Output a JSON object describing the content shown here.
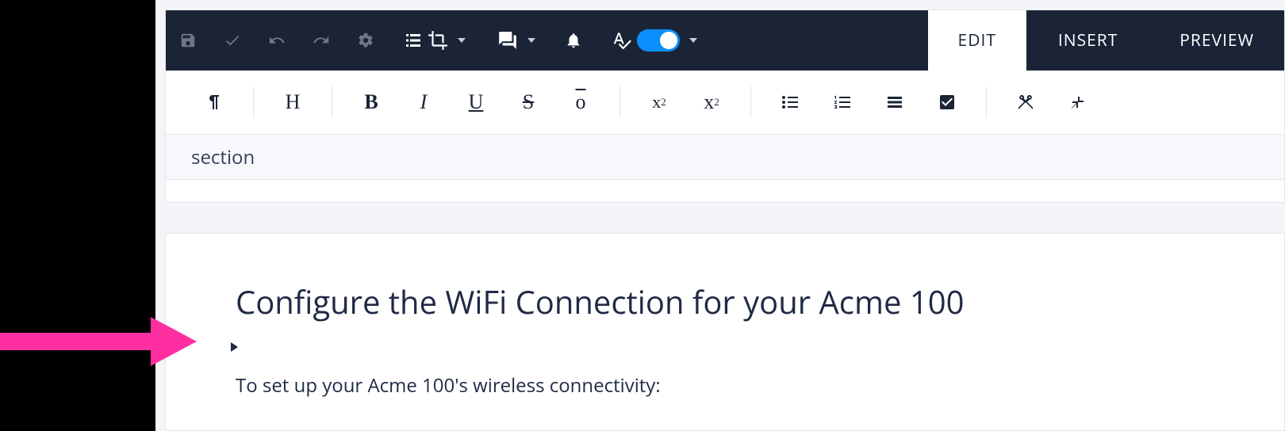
{
  "tabs": {
    "edit": "EDIT",
    "insert": "INSERT",
    "preview": "PREVIEW"
  },
  "breadcrumb": {
    "label": "section"
  },
  "document": {
    "title": "Configure the WiFi Connection for your Acme 100",
    "intro": "To set up your Acme 100's wireless connectivity:"
  },
  "format_buttons": {
    "heading_glyph": "H",
    "bold_glyph": "B",
    "italic_glyph": "I",
    "overline_glyph": "o",
    "super_base": "x",
    "super_exp": "2",
    "sub_base": "x",
    "sub_sub": "2"
  },
  "icons": {
    "save": "save-icon",
    "approve": "check-icon",
    "undo": "undo-icon",
    "redo": "redo-icon",
    "settings": "gear-icon",
    "layout": "layout-icon",
    "comments": "comments-icon",
    "notifications": "bell-icon",
    "spellcheck": "spellcheck-icon"
  }
}
